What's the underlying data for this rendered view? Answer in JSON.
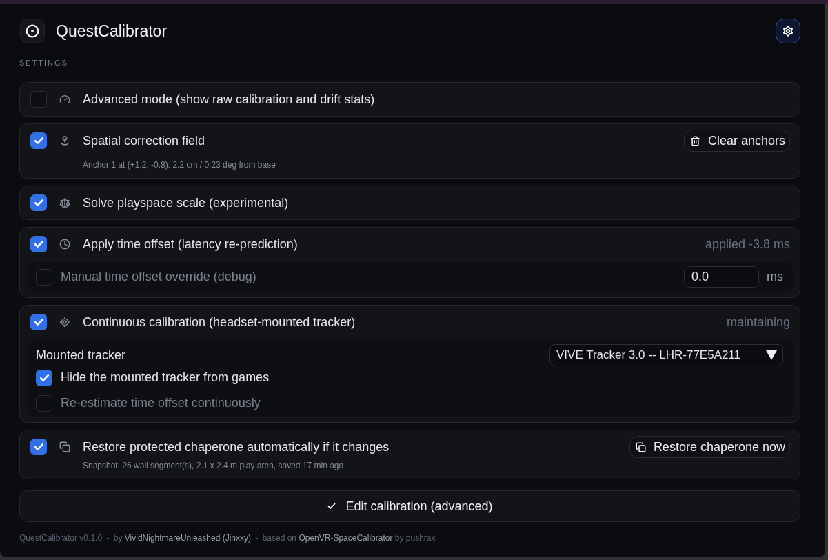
{
  "app": {
    "title": "QuestCalibrator"
  },
  "section_label": "SETTINGS",
  "settings": [
    {
      "label": "Advanced mode (show raw calibration and drift stats)",
      "checked": false
    },
    {
      "label": "Spatial correction field",
      "checked": true,
      "action": {
        "label": "Clear anchors"
      },
      "note": "Anchor 1 at (+1.2, -0.8): 2.2 cm / 0.23 deg from base"
    },
    {
      "label": "Solve playspace scale (experimental)",
      "checked": true
    },
    {
      "label": "Apply time offset (latency re-prediction)",
      "checked": true,
      "status": "applied -3.8 ms",
      "options": [
        {
          "kind": "checkbox",
          "label": "Manual time offset override (debug)",
          "checked": false,
          "input": {
            "value": "0.0",
            "unit": "ms"
          }
        }
      ]
    },
    {
      "label": "Continuous calibration (headset-mounted tracker)",
      "checked": true,
      "status": "maintaining",
      "options": [
        {
          "kind": "select",
          "label": "Mounted tracker",
          "value": "VIVE Tracker 3.0 -- LHR-77E5A211"
        },
        {
          "kind": "checkbox",
          "label": "Hide the mounted tracker from games",
          "checked": true
        },
        {
          "kind": "checkbox",
          "label": "Re-estimate time offset continuously",
          "checked": false
        }
      ]
    },
    {
      "label": "Restore protected chaperone automatically if it changes",
      "checked": true,
      "action": {
        "label": "Restore chaperone now"
      },
      "note": "Snapshot: 26 wall segment(s), 2.1 x 2.4 m play area, saved 17 min ago"
    }
  ],
  "edit_button": {
    "label": "Edit calibration (advanced)"
  },
  "footer": [
    {
      "kind": "text",
      "text": "QuestCalibrator v0.1.0"
    },
    {
      "kind": "sep",
      "text": "-"
    },
    {
      "kind": "text",
      "text": "by"
    },
    {
      "kind": "link",
      "text": "VividNightmareUnleashed (Jinxxy)"
    },
    {
      "kind": "sep",
      "text": "-"
    },
    {
      "kind": "text",
      "text": "based on"
    },
    {
      "kind": "link",
      "text": "OpenVR-SpaceCalibrator"
    },
    {
      "kind": "text",
      "text": "by pushrax"
    }
  ]
}
